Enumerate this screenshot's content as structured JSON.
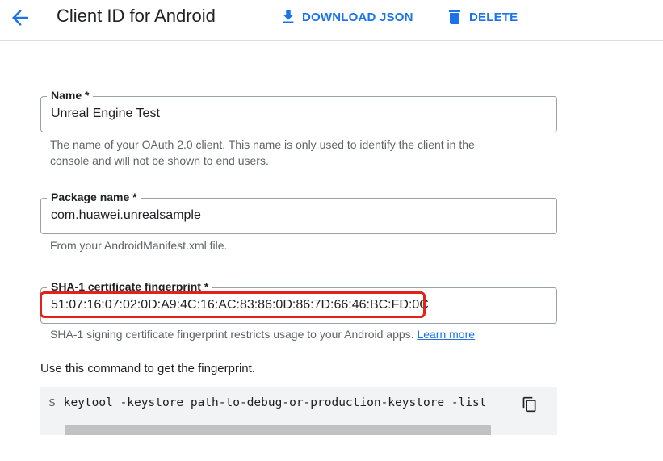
{
  "header": {
    "title": "Client ID for Android",
    "download_label": "DOWNLOAD JSON",
    "delete_label": "DELETE"
  },
  "form": {
    "name": {
      "label": "Name *",
      "value": "Unreal Engine Test",
      "helper_line1": "The name of your OAuth 2.0 client. This name is only used to identify the client in the",
      "helper_line2": "console and will not be shown to end users."
    },
    "package": {
      "label": "Package name *",
      "value": "com.huawei.unrealsample",
      "helper": "From your AndroidManifest.xml file."
    },
    "sha1": {
      "label": "SHA-1 certificate fingerprint *",
      "value": "51:07:16:07:02:0D:A9:4C:16:AC:83:86:0D:86:7D:66:46:BC:FD:0C",
      "helper": "SHA-1 signing certificate fingerprint restricts usage to your Android apps.",
      "learn_more": "Learn more"
    }
  },
  "command": {
    "intro": "Use this command to get the fingerprint.",
    "prompt": "$",
    "text": "keytool -keystore path-to-debug-or-production-keystore -list"
  },
  "colors": {
    "accent": "#1a73e8",
    "highlight": "#e32119",
    "field_border": "#9aa0a6"
  },
  "icons": {
    "back": "arrow-back-icon",
    "download": "download-icon",
    "delete": "trash-icon",
    "copy": "copy-icon"
  }
}
